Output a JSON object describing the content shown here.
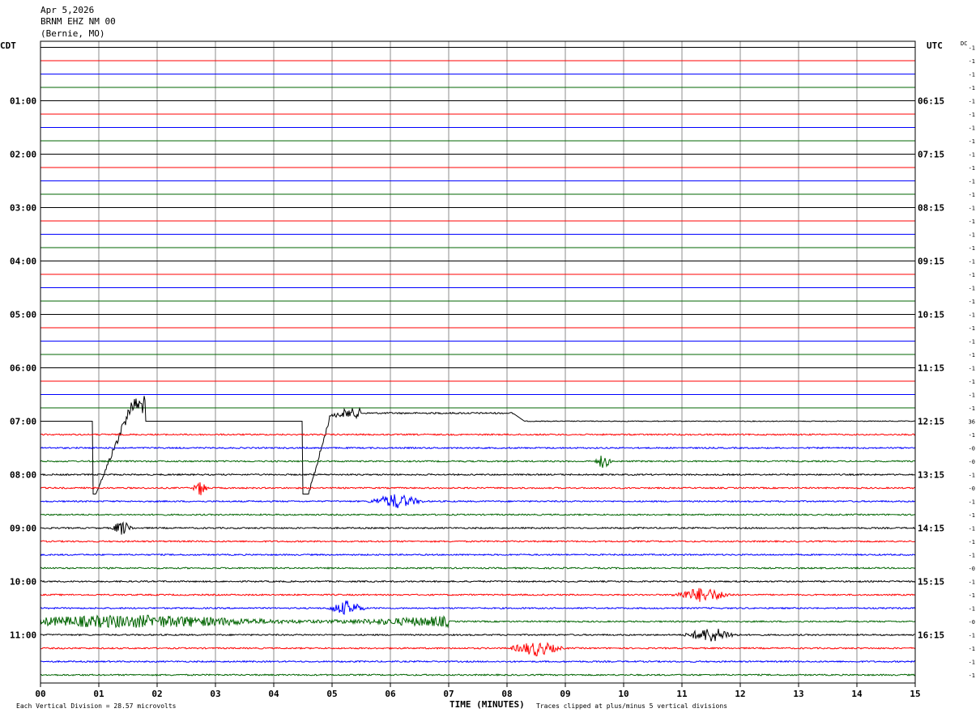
{
  "header": {
    "date": "Apr 5,2026",
    "station": "BRNM EHZ NM 00",
    "location": "(Bernie, MO)"
  },
  "footer": {
    "vertical_division": "Each Vertical Division =   28.57 microvolts",
    "clip_note": "Traces clipped at plus/minus 5 vertical divisions"
  },
  "chart_data": {
    "type": "line",
    "xlabel": "TIME (MINUTES)",
    "x_ticks": [
      "00",
      "01",
      "02",
      "03",
      "04",
      "05",
      "06",
      "07",
      "08",
      "09",
      "10",
      "11",
      "12",
      "13",
      "14",
      "15"
    ],
    "xlim": [
      0,
      15
    ],
    "left_axis_label": "CDT",
    "right_axis_label": "UTC",
    "dc_label": "DC",
    "left_time_labels": [
      "01:00",
      "02:00",
      "03:00",
      "04:00",
      "05:00",
      "06:00",
      "07:00",
      "08:00",
      "09:00",
      "10:00",
      "11:00"
    ],
    "right_time_labels": [
      "06:15",
      "07:15",
      "08:15",
      "09:15",
      "10:15",
      "11:15",
      "12:15",
      "13:15",
      "14:15",
      "15:15",
      "16:15"
    ],
    "trace_colors": [
      "#000000",
      "#ff0000",
      "#0000ff",
      "#006400"
    ],
    "dc_offsets": [
      "-1",
      "-1",
      "-1",
      "-1",
      "-1",
      "-1",
      "-1",
      "-1",
      "-1",
      "-1",
      "-1",
      "-1",
      "-1",
      "-1",
      "-1",
      "-1",
      "-1",
      "-1",
      "-1",
      "-1",
      "-1",
      "-1",
      "-1",
      "-1",
      "-1",
      "-1",
      "-1",
      "-1",
      "36",
      "-1",
      "-0",
      "-0",
      "-1",
      "-0",
      "-1",
      "-1",
      "-1",
      "-1",
      "-1",
      "-0",
      "-1",
      "-1",
      "-1",
      "-0",
      "-1",
      "-1",
      "-1",
      "-1"
    ],
    "events": [
      {
        "trace": 28,
        "start_min": 0.9,
        "end_min": 1.8,
        "kind": "large-noisy-step"
      },
      {
        "trace": 28,
        "start_min": 4.5,
        "end_min": 8.2,
        "kind": "large-step"
      },
      {
        "trace": 31,
        "start_min": 9.5,
        "end_min": 9.8,
        "kind": "burst"
      },
      {
        "trace": 33,
        "start_min": 2.6,
        "end_min": 2.9,
        "kind": "burst"
      },
      {
        "trace": 34,
        "start_min": 5.6,
        "end_min": 6.6,
        "kind": "burst"
      },
      {
        "trace": 36,
        "start_min": 1.2,
        "end_min": 1.6,
        "kind": "burst"
      },
      {
        "trace": 41,
        "start_min": 10.8,
        "end_min": 11.9,
        "kind": "burst"
      },
      {
        "trace": 42,
        "start_min": 4.9,
        "end_min": 5.6,
        "kind": "burst"
      },
      {
        "trace": 43,
        "start_min": 0.0,
        "end_min": 7.0,
        "kind": "noise"
      },
      {
        "trace": 44,
        "start_min": 11.0,
        "end_min": 12.0,
        "kind": "burst"
      },
      {
        "trace": 45,
        "start_min": 8.0,
        "end_min": 9.0,
        "kind": "burst"
      }
    ]
  }
}
